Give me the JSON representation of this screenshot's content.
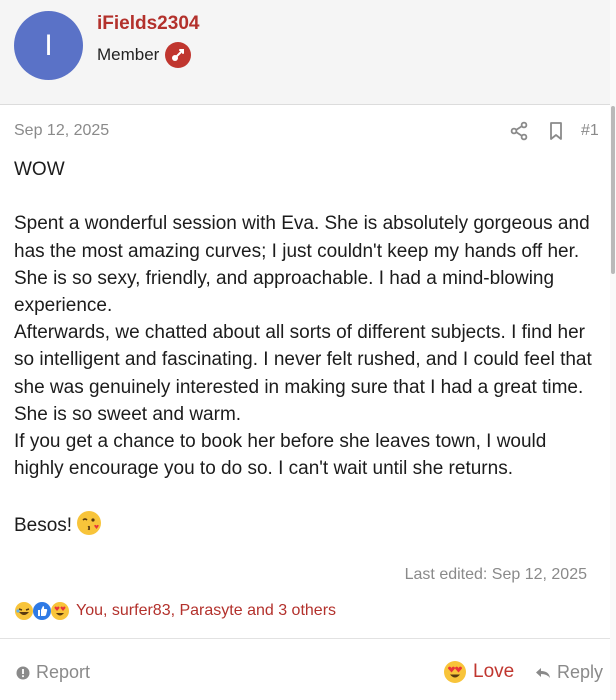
{
  "author": {
    "avatar_letter": "I",
    "username": "iFields2304",
    "role": "Member",
    "role_icon": "member-badge-icon",
    "avatar_color": "#5a72c7",
    "name_color": "#b3312c"
  },
  "post": {
    "date": "Sep 12, 2025",
    "number": "#1",
    "title_line": "WOW",
    "paragraphs": [
      "Spent a wonderful session with Eva. She is absolutely gorgeous and has the most amazing curves; I just couldn't keep my hands off her. She is so sexy, friendly, and approachable. I had a mind-blowing experience.",
      "Afterwards, we chatted about all sorts of different subjects. I find her so intelligent and fascinating. I never felt rushed, and I could feel that she was genuinely interested in making sure that I had a great time. She is so sweet and warm.",
      "If you get a chance to book her before she leaves town, I would highly encourage you to do so. I can't wait until she returns."
    ],
    "signoff": "Besos!",
    "last_edited": "Last edited: Sep 12, 2025"
  },
  "reactions": {
    "icons": [
      "laughing-emoji-icon",
      "thumbs-up-icon",
      "heart-eyes-emoji-icon"
    ],
    "summary": "You, surfer83, Parasyte and 3 others"
  },
  "actions": {
    "report_label": "Report",
    "love_label": "Love",
    "reply_label": "Reply",
    "accent_color": "#c0362f"
  }
}
